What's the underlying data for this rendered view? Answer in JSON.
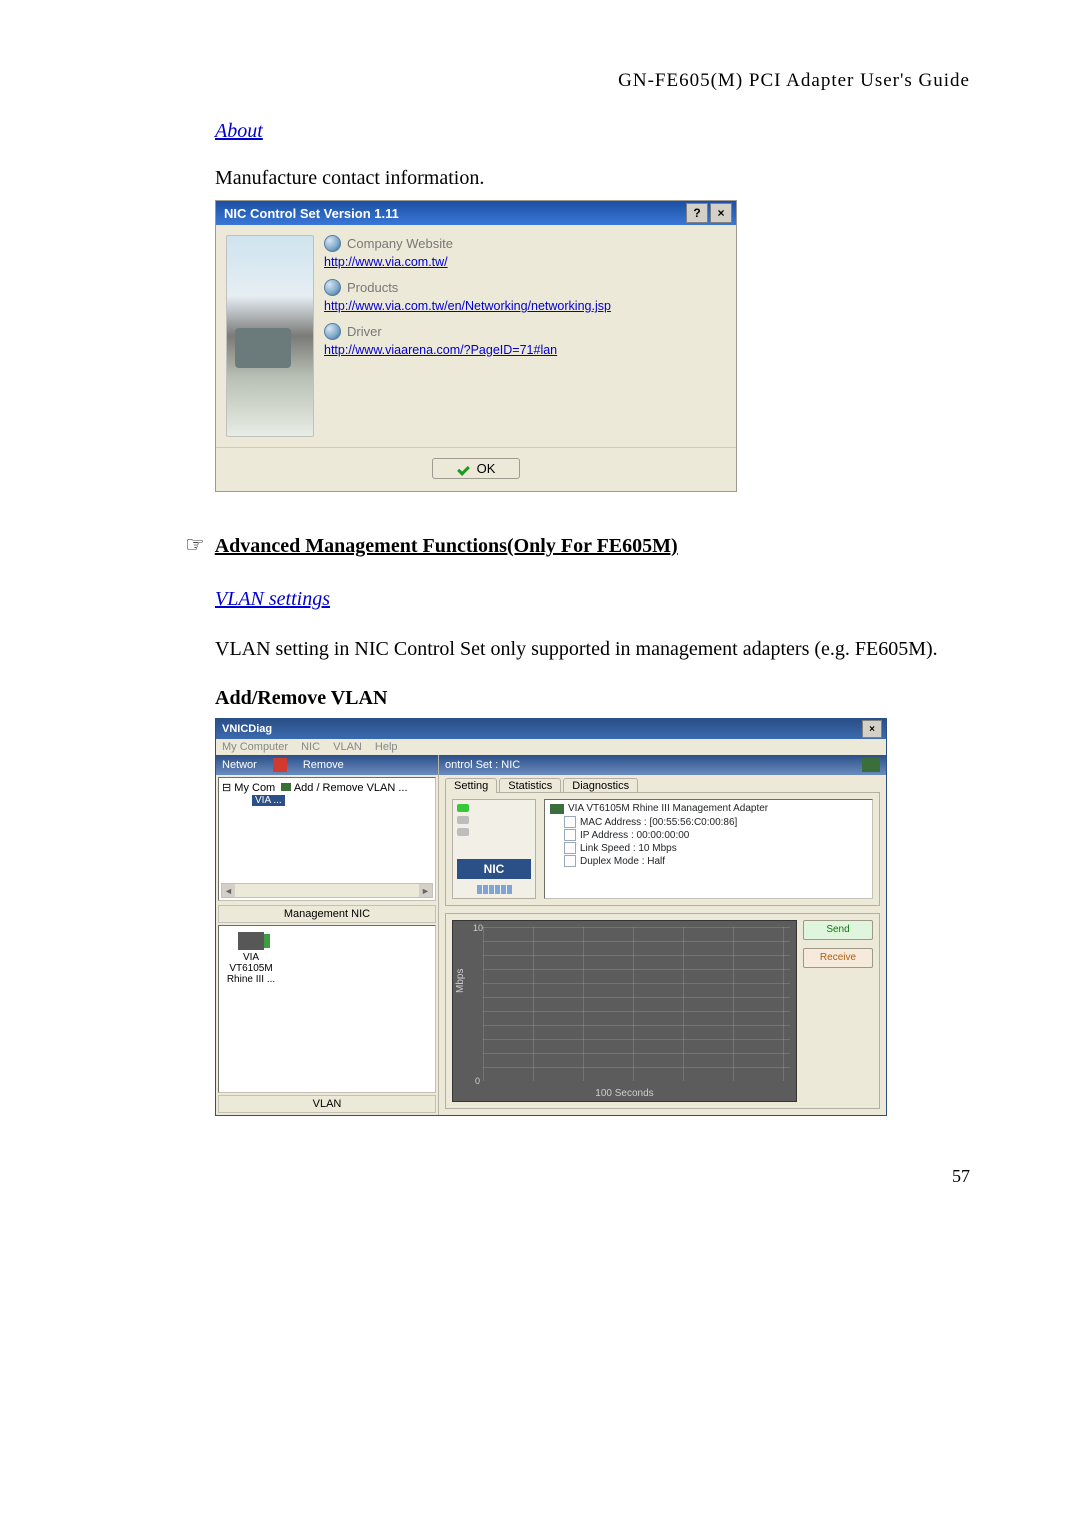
{
  "header": "GN-FE605(M) PCI Adapter User's Guide",
  "about": {
    "heading": "About",
    "lead": "Manufacture contact information."
  },
  "nicDialog": {
    "title": "NIC Control Set  Version 1.11",
    "helpBtn": "?",
    "closeBtn": "×",
    "rows": [
      {
        "label": "Company Website",
        "link": "http://www.via.com.tw/"
      },
      {
        "label": "Products",
        "link": "http://www.via.com.tw/en/Networking/networking.jsp"
      },
      {
        "label": "Driver",
        "link": "http://www.viaarena.com/?PageID=71#lan"
      }
    ],
    "ok": "OK"
  },
  "advanced": {
    "symbol": "☞",
    "heading": "Advanced Management Functions(Only For FE605M)",
    "vlanHeading": "VLAN settings",
    "para": "VLAN setting in NIC Control Set only supported in management adapters (e.g. FE605M).",
    "subhead": "Add/Remove VLAN"
  },
  "vnic": {
    "title": "VNICDiag",
    "close": "×",
    "menu": [
      "My Computer",
      "NIC",
      "VLAN",
      "Help"
    ],
    "left": {
      "networkLabel": "Networ",
      "removeLabel": "Remove",
      "treeTop": "My Com",
      "treeAddRemove": "Add / Remove VLAN ...",
      "treeSelected": "VIA ...",
      "scrollLeft": "◄",
      "scrollRight": "►",
      "mnicHeader": "Management NIC",
      "nicItem1": "VIA VT6105M",
      "nicItem2": "Rhine III ...",
      "vlanHeader": "VLAN"
    },
    "right": {
      "controlSet": "ontrol Set : NIC",
      "tabs": [
        "Setting",
        "Statistics",
        "Diagnostics"
      ],
      "nicTileLabel": "NIC",
      "infoRoot": "VIA VT6105M Rhine III Management Adapter",
      "infoLeaves": [
        "MAC Address : [00:55:56:C0:00:86]",
        "IP Address : 00:00:00:00",
        "Link Speed : 10 Mbps",
        "Duplex Mode : Half"
      ],
      "legendSend": "Send",
      "legendRecv": "Receive"
    }
  },
  "chart_data": {
    "type": "line",
    "title": "",
    "xlabel": "100 Seconds",
    "ylabel": "Mbps",
    "ylim": [
      0,
      10
    ],
    "x": [],
    "series": [
      {
        "name": "Send",
        "values": []
      },
      {
        "name": "Receive",
        "values": []
      }
    ]
  },
  "pageNumber": "57"
}
